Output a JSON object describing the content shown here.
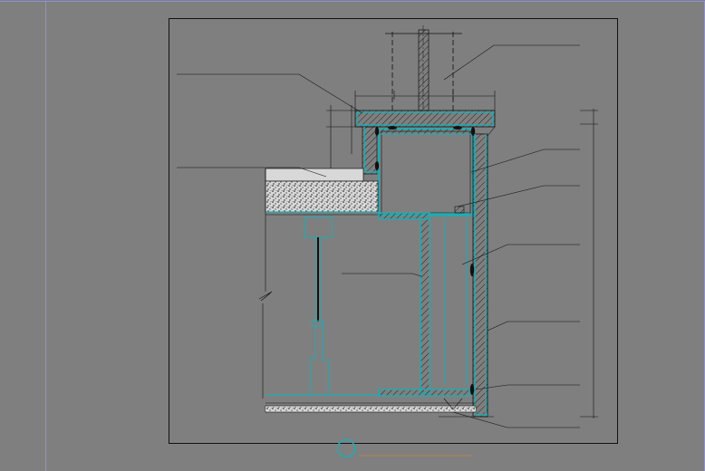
{
  "drawing": {
    "title": "",
    "scale": "",
    "detail_number": ""
  },
  "annotations": [
    {
      "id": "a1",
      "text": ""
    },
    {
      "id": "a2",
      "text": ""
    },
    {
      "id": "a3",
      "text": ""
    },
    {
      "id": "a4",
      "text": ""
    },
    {
      "id": "a5",
      "text": ""
    },
    {
      "id": "a6",
      "text": ""
    },
    {
      "id": "a7",
      "text": ""
    },
    {
      "id": "a8",
      "text": ""
    },
    {
      "id": "a9",
      "text": ""
    },
    {
      "id": "a10",
      "text": ""
    },
    {
      "id": "a11",
      "text": ""
    },
    {
      "id": "a12",
      "text": ""
    }
  ],
  "dimensions": [
    {
      "id": "d1",
      "text": ""
    },
    {
      "id": "d2",
      "text": ""
    },
    {
      "id": "d3",
      "text": ""
    },
    {
      "id": "d4",
      "text": ""
    }
  ],
  "colors": {
    "background": "#7f7f7f",
    "linework": "#111111",
    "steel": "#1aaeb4",
    "annotation": "#c98a3c",
    "viewport": "#8f8fd8"
  }
}
